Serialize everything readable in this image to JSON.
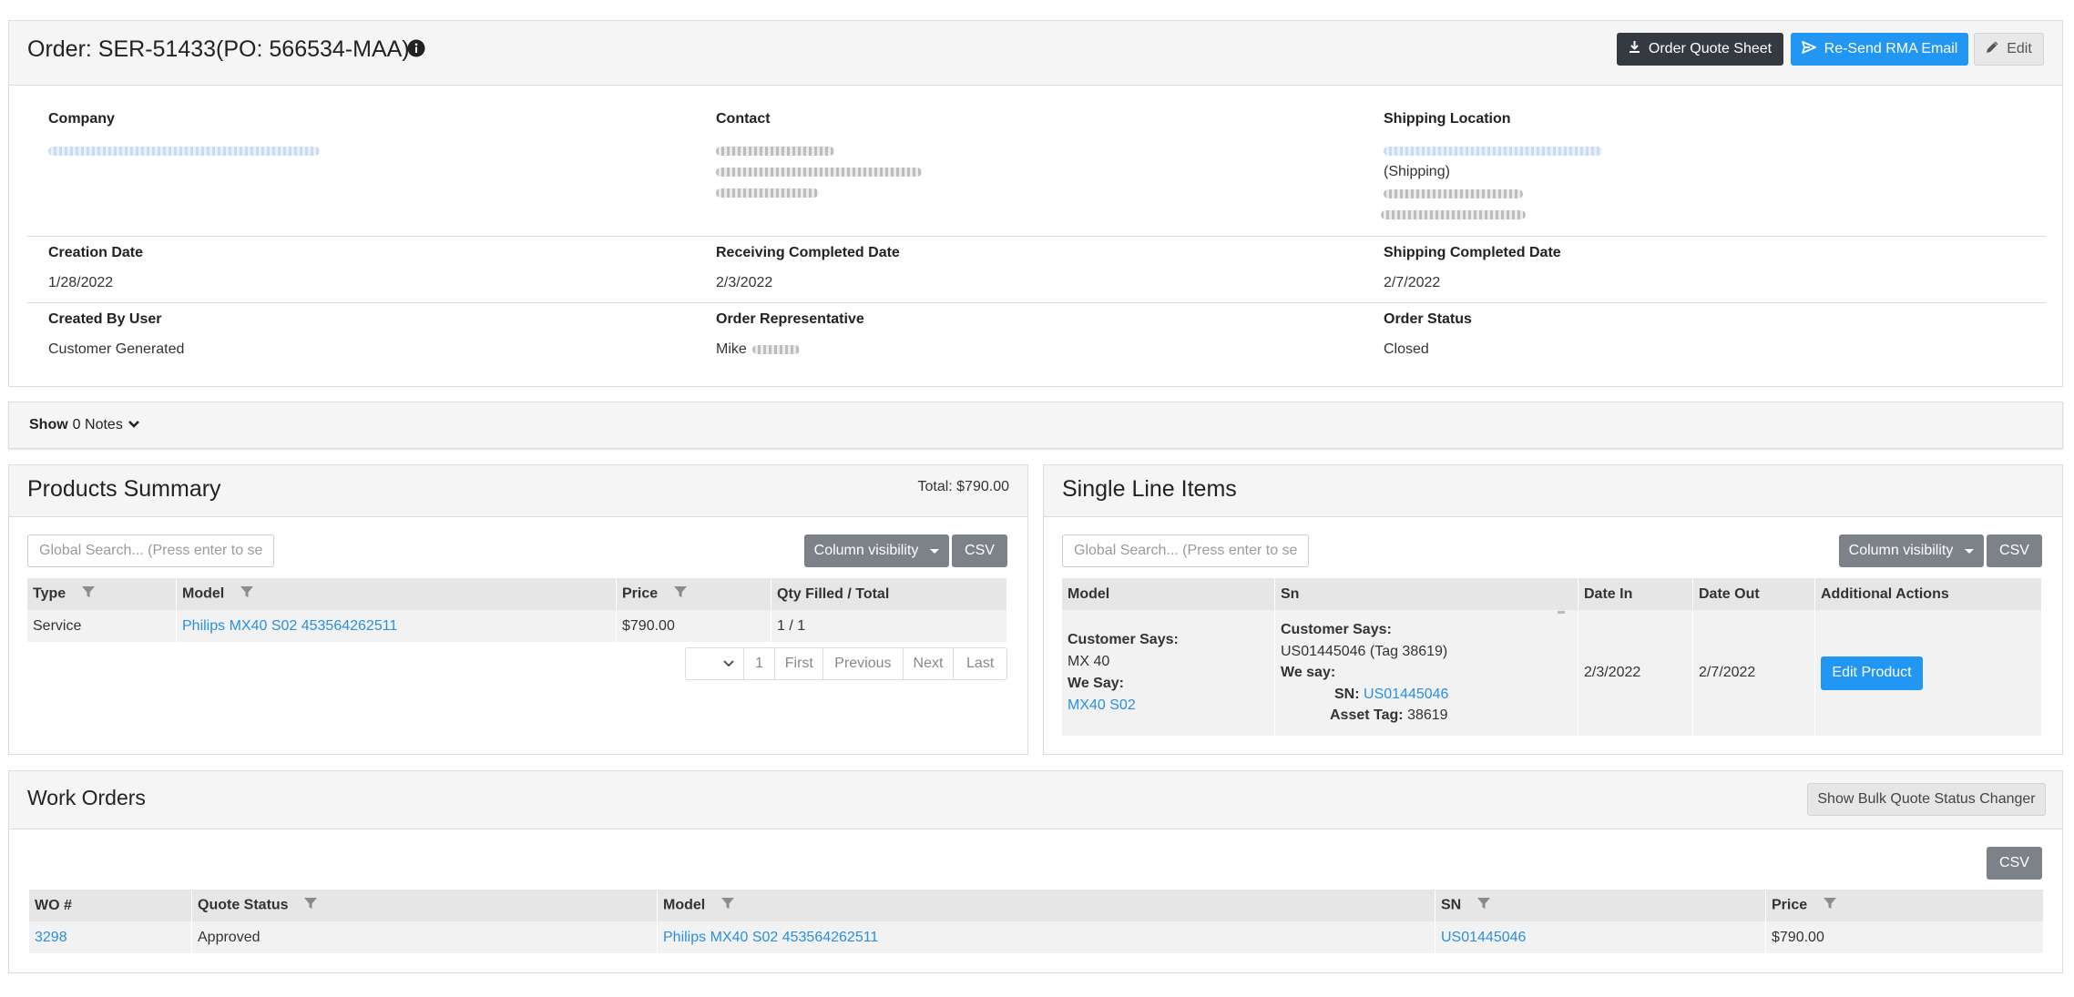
{
  "order": {
    "title": "Order: SER-51433(PO: 566534-MAA)",
    "buttons": {
      "quote_sheet": "Order Quote Sheet",
      "resend_rma": "Re-Send RMA Email",
      "edit": "Edit"
    }
  },
  "info": {
    "company_label": "Company",
    "contact_label": "Contact",
    "shipping_location_label": "Shipping Location",
    "shipping_location_sub": "(Shipping)",
    "creation_date_label": "Creation Date",
    "creation_date": "1/28/2022",
    "receiving_completed_label": "Receiving Completed Date",
    "receiving_completed": "2/3/2022",
    "shipping_completed_label": "Shipping Completed Date",
    "shipping_completed": "2/7/2022",
    "created_by_label": "Created By User",
    "created_by": "Customer Generated",
    "rep_label": "Order Representative",
    "rep": "Mike",
    "status_label": "Order Status",
    "status": "Closed"
  },
  "notes": {
    "show": "Show",
    "count_text": "0 Notes"
  },
  "products_summary": {
    "title": "Products Summary",
    "total": "Total: $790.00",
    "search_placeholder": "Global Search... (Press enter to search)",
    "column_visibility": "Column visibility",
    "csv": "CSV",
    "headers": [
      "Type",
      "Model",
      "Price",
      "Qty Filled / Total"
    ],
    "rows": [
      {
        "type": "Service",
        "model": "Philips MX40 S02 453564262511",
        "price": "$790.00",
        "qty": "1 / 1"
      }
    ],
    "pager": {
      "page": "1",
      "first": "First",
      "previous": "Previous",
      "next": "Next",
      "last": "Last"
    }
  },
  "single_line_items": {
    "title": "Single Line Items",
    "search_placeholder": "Global Search... (Press enter to search)",
    "column_visibility": "Column visibility",
    "csv": "CSV",
    "headers": [
      "Model",
      "Sn",
      "Date In",
      "Date Out",
      "Additional Actions"
    ],
    "row": {
      "customer_says_label": "Customer Says:",
      "customer_model": "MX 40",
      "we_say_label": "We Say:",
      "we_model": "MX40 S02",
      "sn_customer_says_label": "Customer Says:",
      "sn_customer": "US01445046 (Tag 38619)",
      "sn_we_say_label": "We say:",
      "sn_label": "SN:",
      "sn_value": "US01445046",
      "asset_tag_label": "Asset Tag:",
      "asset_tag": "38619",
      "date_in": "2/3/2022",
      "date_out": "2/7/2022",
      "action": "Edit Product"
    }
  },
  "work_orders": {
    "title": "Work Orders",
    "bulk_button": "Show Bulk Quote Status Changer",
    "csv": "CSV",
    "headers": [
      "WO #",
      "Quote Status",
      "Model",
      "SN",
      "Price"
    ],
    "rows": [
      {
        "wo": "3298",
        "quote_status": "Approved",
        "model": "Philips MX40 S02 453564262511",
        "sn": "US01445046",
        "price": "$790.00"
      }
    ]
  }
}
